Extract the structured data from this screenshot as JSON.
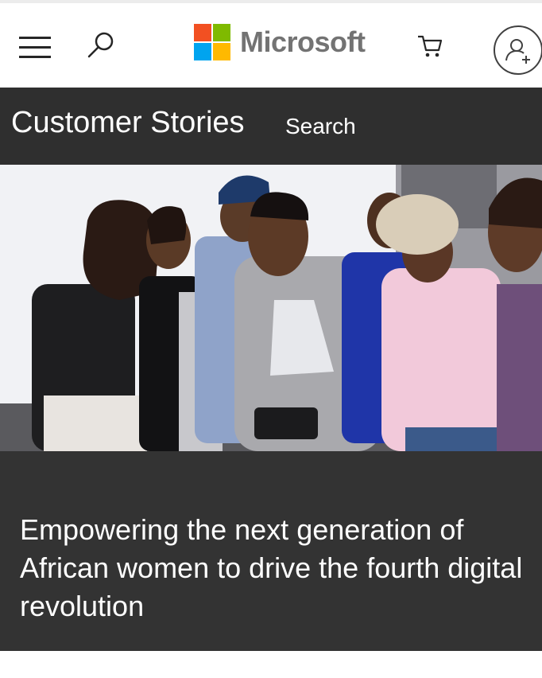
{
  "header": {
    "brand": "Microsoft",
    "logo_colors": [
      "#f25022",
      "#7fba00",
      "#00a4ef",
      "#ffb900"
    ],
    "icons": [
      "menu-icon",
      "search-icon",
      "cart-icon",
      "account-add-icon"
    ]
  },
  "subnav": {
    "title": "Customer Stories",
    "search_label": "Search"
  },
  "hero": {
    "image": "photo-students-looking-at-tablet"
  },
  "story": {
    "headline": "Empowering the next generation of African women to drive the fourth digital revolution"
  },
  "colors": {
    "subnav_bg": "#2f2f2f",
    "story_bg": "#333333",
    "text_on_dark": "#ffffff"
  }
}
